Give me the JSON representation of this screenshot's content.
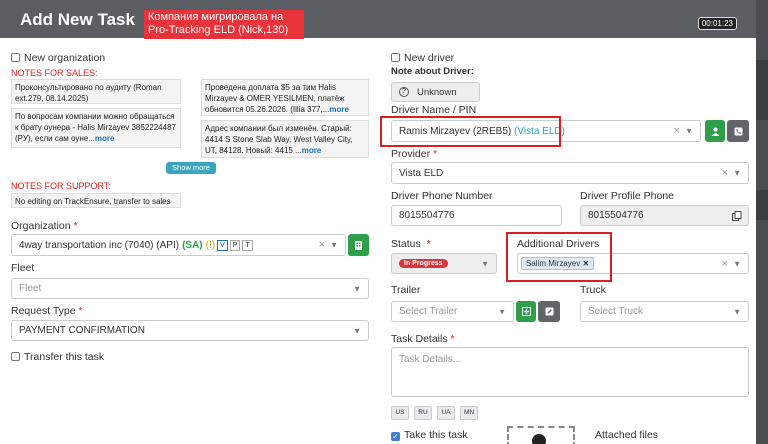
{
  "header": {
    "title": "Add New Task",
    "alert": "Компания мигрировала на Pro-Tracking ELD (Nick,130)",
    "timer": "00:01:23"
  },
  "left": {
    "new_org_label": "New organization",
    "notes_sales_label": "NOTES FOR SALES:",
    "notes_sales": [
      {
        "text": "Проконсультировано по аудиту (Roman ext.279, 08.14.2025)",
        "more": ""
      },
      {
        "text": "Проведена доплата $5 за тим Halis Mirzayev & OMER YESILMEN, платёж обновится 05.26.2026. (Illia 377,...",
        "more": "more"
      },
      {
        "text": "По вопросам компании можно обращаться к брату оунера - Halis Mirzayev 3852224487 (РУ), если сам оуне...",
        "more": "more"
      },
      {
        "text": "Адрес компании был изменён. Старый: 4414 S Stone Slab Way, West Valley City, UT, 84128. Новый: 4415 ...",
        "more": "more"
      }
    ],
    "show_more": "Show more",
    "notes_support_label": "NOTES FOR SUPPORT:",
    "notes_support": "No editing on TrackEnsure, transfer to sales",
    "organization_label": "Organization",
    "organization_value": "4way transportation inc (7040) (API)",
    "organization_sa": "(SA)",
    "organization_flag": "(!)",
    "organization_tags": [
      "V",
      "P",
      "T"
    ],
    "fleet_label": "Fleet",
    "fleet_placeholder": "Fleet",
    "request_type_label": "Request Type",
    "request_type_value": "PAYMENT CONFIRMATION",
    "transfer_label": "Transfer this task"
  },
  "right": {
    "new_driver_label": "New driver",
    "note_driver_label": "Note about Driver:",
    "unknown_label": "Unknown",
    "driver_label": "Driver Name / PIN",
    "driver_name": "Ramis Mirzayev (2REB5)",
    "driver_eld": "(Vista ELD)",
    "provider_label": "Provider",
    "provider_value": "Vista ELD",
    "driver_phone_label": "Driver Phone Number",
    "driver_phone_value": "8015504776",
    "profile_phone_label": "Driver Profile Phone",
    "profile_phone_value": "8015504776",
    "status_label": "Status",
    "status_value": "In Progress",
    "additional_label": "Additional Drivers",
    "additional_value": "Salim Mirzayev",
    "trailer_label": "Trailer",
    "trailer_placeholder": "Select Trailer",
    "truck_label": "Truck",
    "truck_placeholder": "Select Truck",
    "details_label": "Task Details",
    "details_placeholder": "Task Details...",
    "langs": [
      "US",
      "RU",
      "UA",
      "MN"
    ],
    "take_label": "Take this task",
    "attached_label": "Attached files"
  },
  "colors": {
    "alert": "#e8333b",
    "header": "#5a5e63",
    "link": "#1b6fb8",
    "green": "#2e9e48",
    "highlight": "#d81f26"
  }
}
